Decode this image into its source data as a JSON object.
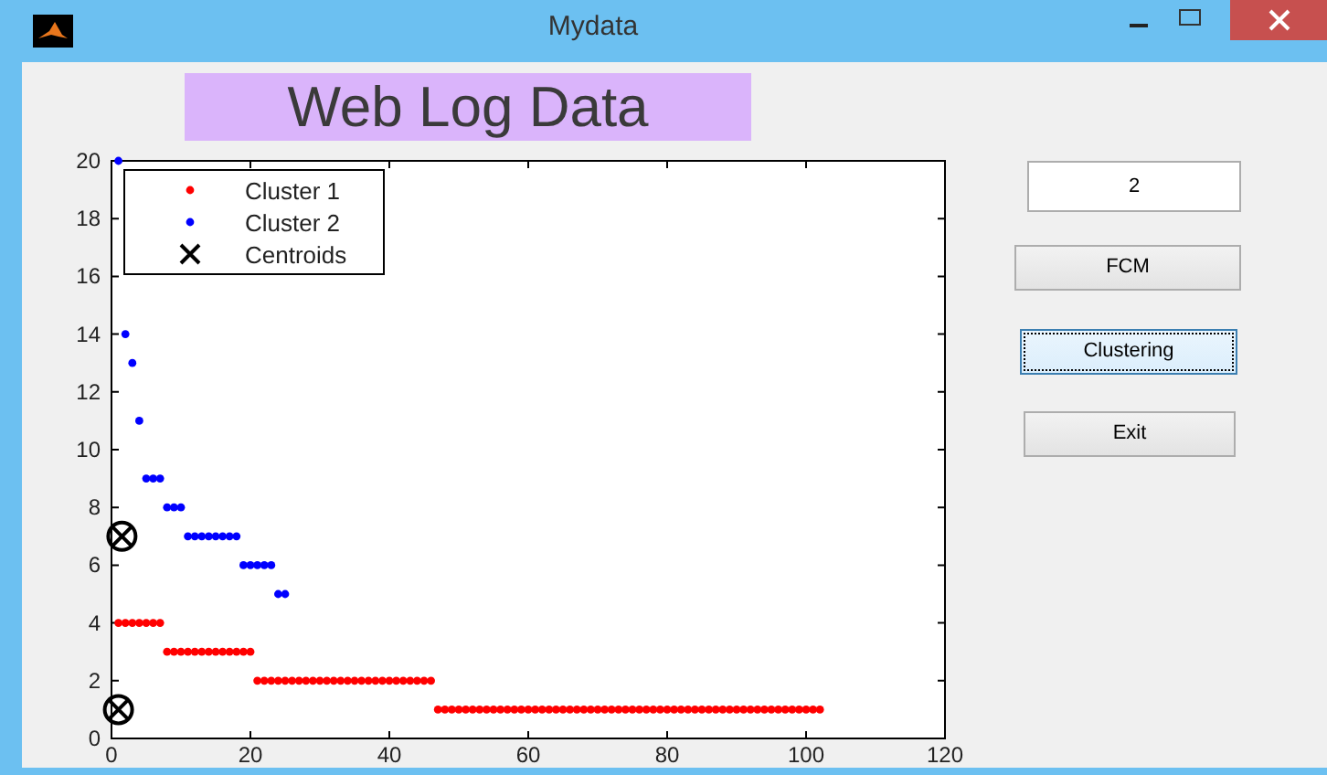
{
  "window": {
    "title": "Mydata"
  },
  "heading": "Web Log Data",
  "cluster_count_field": {
    "value": "2"
  },
  "buttons": [
    {
      "label": "FCM",
      "focused": false
    },
    {
      "label": "Clustering",
      "focused": true
    },
    {
      "label": "Exit",
      "focused": false
    }
  ],
  "plot": {
    "chart_data": {
      "type": "scatter",
      "xlim": [
        0,
        120
      ],
      "ylim": [
        0,
        20
      ],
      "xticks": [
        0,
        20,
        40,
        60,
        80,
        100,
        120
      ],
      "yticks": [
        0,
        2,
        4,
        6,
        8,
        10,
        12,
        14,
        16,
        18,
        20
      ],
      "legend": true,
      "series": [
        {
          "name": "Cluster 1",
          "marker": "point",
          "color": "#ff0000",
          "x": [
            1,
            2,
            3,
            4,
            5,
            6,
            7,
            8,
            9,
            10,
            11,
            12,
            13,
            14,
            15,
            16,
            17,
            18,
            19,
            20,
            21,
            22,
            23,
            24,
            25,
            26,
            27,
            28,
            29,
            30,
            31,
            32,
            33,
            34,
            35,
            36,
            37,
            38,
            39,
            40,
            41,
            42,
            43,
            44,
            45,
            46,
            47,
            48,
            49,
            50,
            51,
            52,
            53,
            54,
            55,
            56,
            57,
            58,
            59,
            60,
            61,
            62,
            63,
            64,
            65,
            66,
            67,
            68,
            69,
            70,
            71,
            72,
            73,
            74,
            75,
            76,
            77,
            78,
            79,
            80,
            81,
            82,
            83,
            84,
            85,
            86,
            87,
            88,
            89,
            90,
            91,
            92,
            93,
            94,
            95,
            96,
            97,
            98,
            99,
            100,
            101,
            102
          ],
          "values": [
            4,
            4,
            4,
            4,
            4,
            4,
            4,
            3,
            3,
            3,
            3,
            3,
            3,
            3,
            3,
            3,
            3,
            3,
            3,
            3,
            2,
            2,
            2,
            2,
            2,
            2,
            2,
            2,
            2,
            2,
            2,
            2,
            2,
            2,
            2,
            2,
            2,
            2,
            2,
            2,
            2,
            2,
            2,
            2,
            2,
            2,
            1,
            1,
            1,
            1,
            1,
            1,
            1,
            1,
            1,
            1,
            1,
            1,
            1,
            1,
            1,
            1,
            1,
            1,
            1,
            1,
            1,
            1,
            1,
            1,
            1,
            1,
            1,
            1,
            1,
            1,
            1,
            1,
            1,
            1,
            1,
            1,
            1,
            1,
            1,
            1,
            1,
            1,
            1,
            1,
            1,
            1,
            1,
            1,
            1,
            1,
            1,
            1,
            1,
            1,
            1,
            1
          ]
        },
        {
          "name": "Cluster 2",
          "marker": "point",
          "color": "#0000ff",
          "x": [
            1,
            2,
            3,
            4,
            5,
            6,
            7,
            8,
            9,
            10,
            11,
            12,
            13,
            14,
            15,
            16,
            17,
            18,
            19,
            20,
            21,
            22,
            23,
            24,
            25
          ],
          "values": [
            20,
            14,
            13,
            11,
            9,
            9,
            9,
            8,
            8,
            8,
            7,
            7,
            7,
            7,
            7,
            7,
            7,
            7,
            6,
            6,
            6,
            6,
            6,
            5,
            5
          ]
        },
        {
          "name": "Centroids",
          "marker": "circled-x",
          "color": "#000000",
          "x": [
            1.5,
            1
          ],
          "values": [
            7,
            1
          ]
        }
      ]
    }
  }
}
